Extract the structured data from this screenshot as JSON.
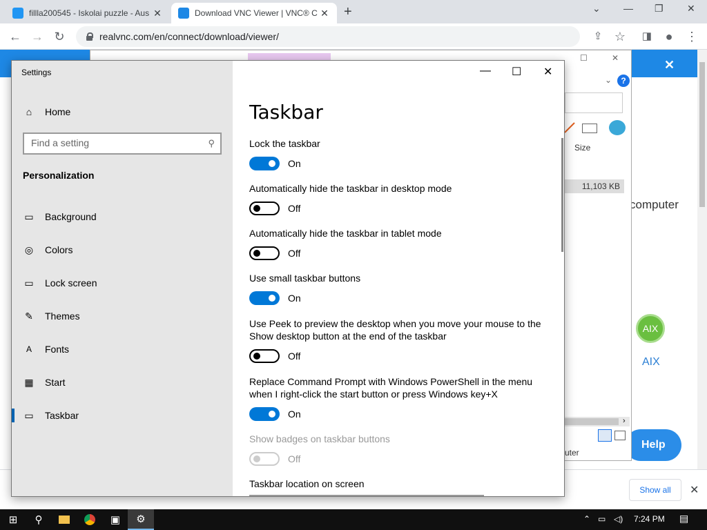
{
  "browser": {
    "tabs": [
      {
        "title": "fillla200545 - Iskolai puzzle - Aus",
        "close": "✕"
      },
      {
        "title": "Download VNC Viewer | VNC® C",
        "close": "✕"
      }
    ],
    "new_tab": "+",
    "url": "realvnc.com/en/connect/download/viewer/",
    "window_controls": {
      "minimize": "—",
      "restore": "❐",
      "close": "✕"
    }
  },
  "webpage": {
    "banner_close": "✕",
    "computer_text": "computer",
    "aix_logo": "AIX",
    "aix_label": "AIX",
    "help_button": "Help",
    "bg_column_size": "Size",
    "bg_file_size": "11,103 KB",
    "bg_help": "?",
    "bg_puter": "uter"
  },
  "download_bar": {
    "show_all": "Show all",
    "close": "✕"
  },
  "settings": {
    "app_title": "Settings",
    "home": "Home",
    "search_placeholder": "Find a setting",
    "section": "Personalization",
    "nav": [
      {
        "label": "Background",
        "icon": "image-icon"
      },
      {
        "label": "Colors",
        "icon": "palette-icon"
      },
      {
        "label": "Lock screen",
        "icon": "lock-screen-icon"
      },
      {
        "label": "Themes",
        "icon": "themes-icon"
      },
      {
        "label": "Fonts",
        "icon": "fonts-icon"
      },
      {
        "label": "Start",
        "icon": "start-icon"
      },
      {
        "label": "Taskbar",
        "icon": "taskbar-icon"
      }
    ],
    "page_title": "Taskbar",
    "options": [
      {
        "label": "Lock the taskbar",
        "state": "On"
      },
      {
        "label": "Automatically hide the taskbar in desktop mode",
        "state": "Off"
      },
      {
        "label": "Automatically hide the taskbar in tablet mode",
        "state": "Off"
      },
      {
        "label": "Use small taskbar buttons",
        "state": "On"
      },
      {
        "label": "Use Peek to preview the desktop when you move your mouse to the Show desktop button at the end of the taskbar",
        "state": "Off"
      },
      {
        "label": "Replace Command Prompt with Windows PowerShell in the menu when I right-click the start button or press Windows key+X",
        "state": "On"
      },
      {
        "label": "Show badges on taskbar buttons",
        "state": "Off"
      }
    ],
    "location_label": "Taskbar location on screen"
  },
  "taskbar": {
    "time": "7:24 PM"
  }
}
